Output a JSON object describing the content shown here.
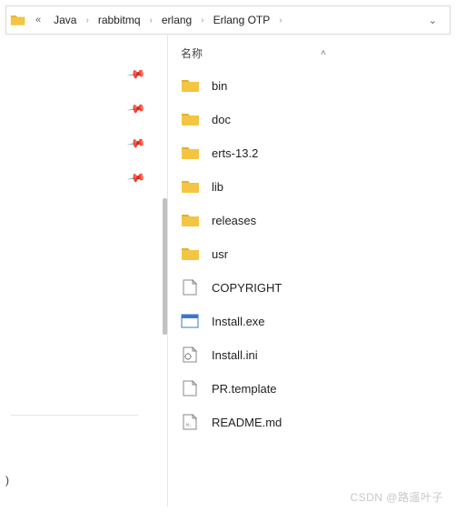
{
  "breadcrumb": {
    "items": [
      "Java",
      "rabbitmq",
      "erlang",
      "Erlang OTP"
    ]
  },
  "columns": {
    "name": "名称"
  },
  "files": [
    {
      "name": "bin",
      "type": "folder"
    },
    {
      "name": "doc",
      "type": "folder"
    },
    {
      "name": "erts-13.2",
      "type": "folder"
    },
    {
      "name": "lib",
      "type": "folder"
    },
    {
      "name": "releases",
      "type": "folder"
    },
    {
      "name": "usr",
      "type": "folder"
    },
    {
      "name": "COPYRIGHT",
      "type": "file"
    },
    {
      "name": "Install.exe",
      "type": "exe"
    },
    {
      "name": "Install.ini",
      "type": "ini"
    },
    {
      "name": "PR.template",
      "type": "file"
    },
    {
      "name": "README.md",
      "type": "md"
    }
  ],
  "watermark": "CSDN @路遥叶子",
  "bracket": ")"
}
